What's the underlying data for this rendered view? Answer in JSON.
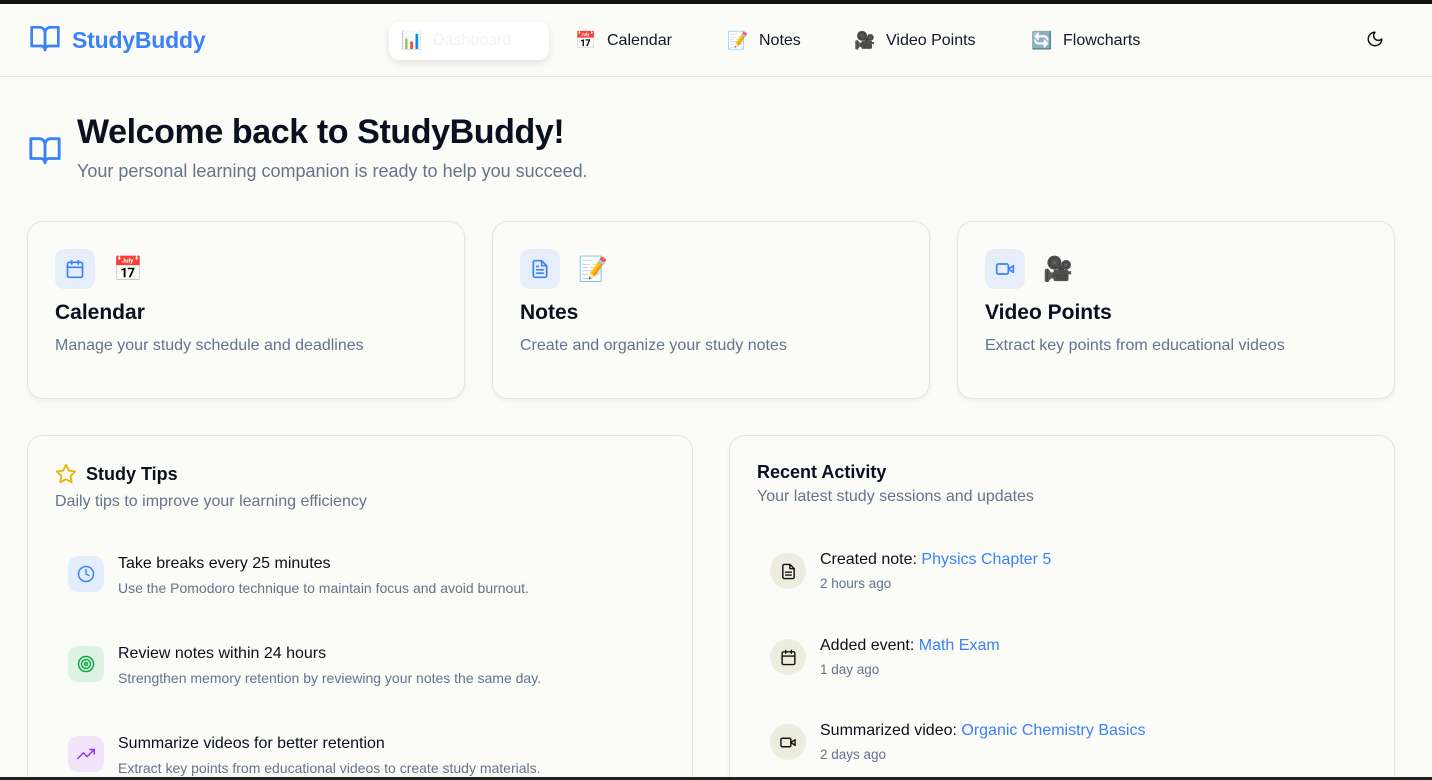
{
  "brand": {
    "name": "StudyBuddy",
    "icon": "book-open-icon",
    "color": "#3b82f6"
  },
  "nav": {
    "items": [
      {
        "label": "Dashboard",
        "icon": "bar-chart-emoji",
        "glyph": "📊"
      },
      {
        "label": "Calendar",
        "icon": "calendar-emoji",
        "glyph": "📅"
      },
      {
        "label": "Notes",
        "icon": "memo-emoji",
        "glyph": "📝"
      },
      {
        "label": "Video Points",
        "icon": "movie-camera-emoji",
        "glyph": "🎥"
      },
      {
        "label": "Flowcharts",
        "icon": "refresh-emoji",
        "glyph": "🔄"
      }
    ],
    "active_index": 0,
    "theme_toggle_icon": "moon-icon"
  },
  "header": {
    "title": "Welcome back to StudyBuddy!",
    "subtitle": "Your personal learning companion is ready to help you succeed."
  },
  "features": [
    {
      "title": "Calendar",
      "description": "Manage your study schedule and deadlines",
      "icon": "calendar-icon",
      "glyph": "📅"
    },
    {
      "title": "Notes",
      "description": "Create and organize your study notes",
      "icon": "file-text-icon",
      "glyph": "📝"
    },
    {
      "title": "Video Points",
      "description": "Extract key points from educational videos",
      "icon": "video-icon",
      "glyph": "🎥"
    }
  ],
  "study_tips": {
    "title": "Study Tips",
    "subtitle": "Daily tips to improve your learning efficiency",
    "icon": "star-icon",
    "tips": [
      {
        "title": "Take breaks every 25 minutes",
        "description": "Use the Pomodoro technique to maintain focus and avoid burnout.",
        "icon": "clock-icon",
        "color": "#3b82f6",
        "bg": "#e3edfc"
      },
      {
        "title": "Review notes within 24 hours",
        "description": "Strengthen memory retention by reviewing your notes the same day.",
        "icon": "target-icon",
        "color": "#16a34a",
        "bg": "#dcf5e3"
      },
      {
        "title": "Summarize videos for better retention",
        "description": "Extract key points from educational videos to create study materials.",
        "icon": "trending-up-icon",
        "color": "#9333ea",
        "bg": "#f1e4fb"
      }
    ]
  },
  "recent_activity": {
    "title": "Recent Activity",
    "subtitle": "Your latest study sessions and updates",
    "items": [
      {
        "prefix": "Created note:",
        "link": "Physics Chapter 5",
        "time": "2 hours ago",
        "icon": "file-text-icon"
      },
      {
        "prefix": "Added event:",
        "link": "Math Exam",
        "time": "1 day ago",
        "icon": "calendar-icon"
      },
      {
        "prefix": "Summarized video:",
        "link": "Organic Chemistry Basics",
        "time": "2 days ago",
        "icon": "video-icon"
      }
    ]
  },
  "colors": {
    "accent": "#3b82f6",
    "background": "#fbfbf7",
    "muted": "#64748b"
  }
}
